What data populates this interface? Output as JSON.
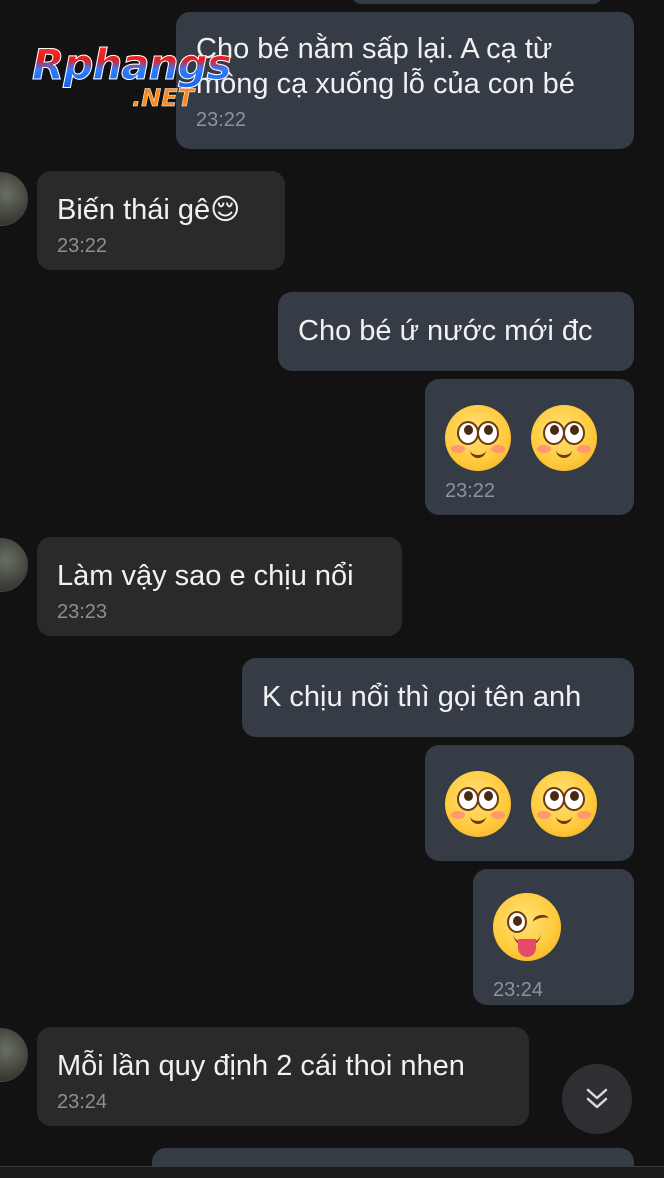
{
  "watermark": {
    "brand": "Rphangs",
    "suffix": ".NET"
  },
  "messages": [
    {
      "direction": "out",
      "text": "Cho bé nằm sấp lại. A cạ từ\nmông cạ xuống lỗ của con bé",
      "time": "23:22"
    },
    {
      "direction": "in",
      "text": "Biến thái gê😌",
      "time": "23:22"
    },
    {
      "direction": "out",
      "text": "Cho bé ứ nước mới đc",
      "time": ""
    },
    {
      "direction": "out",
      "emoji": [
        "face-with-rolling-eyes-blush",
        "face-with-rolling-eyes-blush"
      ],
      "time": "23:22"
    },
    {
      "direction": "in",
      "text": "Làm vậy sao e chịu nổi",
      "time": "23:23"
    },
    {
      "direction": "out",
      "text": "K chịu nổi thì gọi tên anh",
      "time": ""
    },
    {
      "direction": "out",
      "emoji": [
        "face-with-rolling-eyes-blush",
        "face-with-rolling-eyes-blush"
      ],
      "time": ""
    },
    {
      "direction": "out",
      "emoji": [
        "winking-face-with-tongue"
      ],
      "time": "23:24"
    },
    {
      "direction": "in",
      "text": "Mỗi lần quy định 2 cái thoi nhen",
      "time": "23:24"
    }
  ],
  "scroll_button": {
    "icon": "double-chevron-down-icon"
  },
  "colors": {
    "background": "#121212",
    "outgoing_bubble": "#363c45",
    "incoming_bubble": "#2a2a2a",
    "timestamp": "#8c939c"
  }
}
